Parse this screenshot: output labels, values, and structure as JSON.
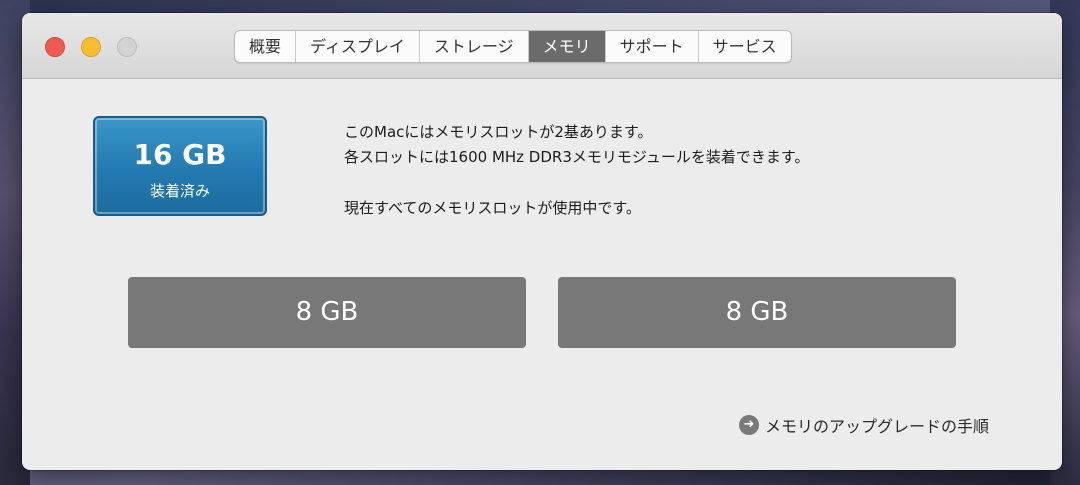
{
  "tabs": [
    {
      "label": "概要"
    },
    {
      "label": "ディスプレイ"
    },
    {
      "label": "ストレージ"
    },
    {
      "label": "メモリ"
    },
    {
      "label": "サポート"
    },
    {
      "label": "サービス"
    }
  ],
  "active_tab": "メモリ",
  "memory": {
    "total": "16 GB",
    "status": "装着済み",
    "info_lines": [
      "このMacにはメモリスロットが2基あります。",
      "各スロットには1600 MHz DDR3メモリモジュールを装着できます。",
      "現在すべてのメモリスロットが使用中です。"
    ],
    "slots": [
      {
        "label": "8 GB"
      },
      {
        "label": "8 GB"
      }
    ]
  },
  "upgrade_link": {
    "label": "メモリのアップグレードの手順",
    "icon": "arrow-circle-right-icon",
    "glyph": "➜"
  },
  "colors": {
    "accent": "#2b84bb",
    "slot": "#787878",
    "active_tab": "#6b6b6b"
  }
}
